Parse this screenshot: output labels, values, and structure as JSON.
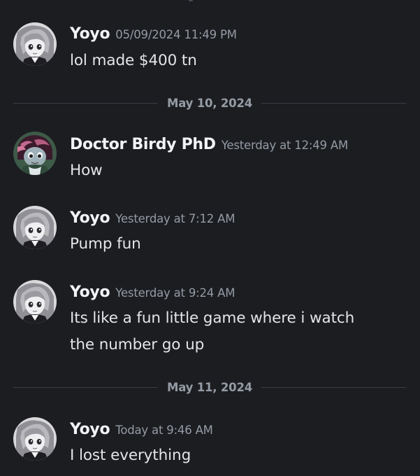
{
  "messages": [
    {
      "username": "Yoyo",
      "timestamp": "05/09/2024 11:49 PM",
      "lines": [
        "lol made $400 tn"
      ],
      "avatar_icon": "yoyo-avatar-icon"
    },
    {
      "username": "Doctor Birdy PhD",
      "timestamp": "Yesterday at 12:49 AM",
      "lines": [
        "How"
      ],
      "avatar_icon": "birdy-avatar-icon"
    },
    {
      "username": "Yoyo",
      "timestamp": "Yesterday at 7:12 AM",
      "lines": [
        "Pump fun"
      ],
      "avatar_icon": "yoyo-avatar-icon"
    },
    {
      "username": "Yoyo",
      "timestamp": "Yesterday at 9:24 AM",
      "lines": [
        "Its like a fun little game where i watch",
        "the number go up"
      ],
      "avatar_icon": "yoyo-avatar-icon"
    },
    {
      "username": "Yoyo",
      "timestamp": "Today at 9:46 AM",
      "lines": [
        "I lost everything"
      ],
      "avatar_icon": "yoyo-avatar-icon"
    }
  ],
  "dividers": [
    {
      "label": "May 10, 2024"
    },
    {
      "label": "May 11, 2024"
    }
  ],
  "colors": {
    "background": "#1c1d21",
    "username": "#f2f3f5",
    "timestamp": "#949ba4",
    "message_text": "#e3e5e8",
    "divider_line": "#3b3d44"
  }
}
